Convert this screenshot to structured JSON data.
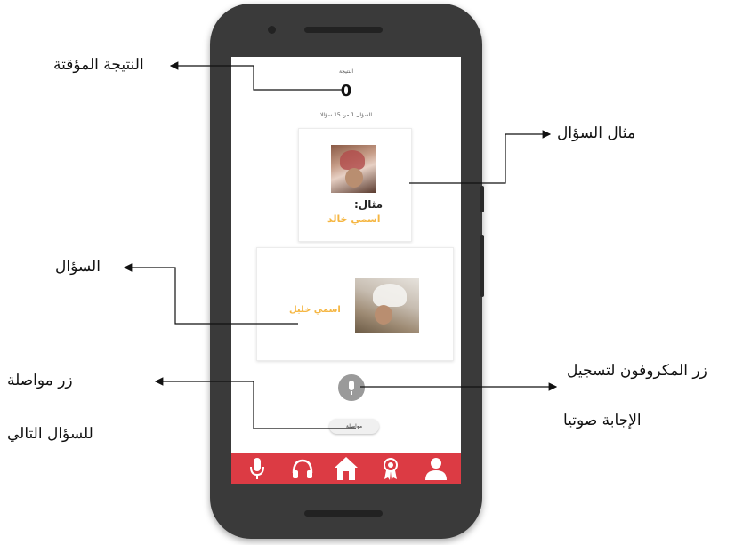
{
  "app": {
    "score_label": "النتيجة",
    "score_value": "0",
    "progress_text": "السؤال 1 من 15 سؤالا",
    "example_label": "مثال:",
    "example_name": "اسمي خالد",
    "question_name": "اسمي خليل",
    "continue_label": "مواصلة",
    "mic_icon": "mic-icon",
    "nav": [
      {
        "name": "nav-mic",
        "icon": "mic-icon"
      },
      {
        "name": "nav-headphones",
        "icon": "headphones-icon"
      },
      {
        "name": "nav-home",
        "icon": "home-icon"
      },
      {
        "name": "nav-award",
        "icon": "award-icon"
      },
      {
        "name": "nav-profile",
        "icon": "user-icon"
      }
    ],
    "colors": {
      "nav_bar": "#dc3b44",
      "name_text": "#f5b642",
      "mic_button": "#9a9a9a"
    }
  },
  "annotations": {
    "temp_score": "النتيجة المؤقتة",
    "question_example": "مثال السؤال",
    "question": "السؤال",
    "continue_line1": "زر مواصلة",
    "continue_line2": "للسؤال التالي",
    "mic_line1": "زر المكروفون لتسجيل",
    "mic_line2": "الإجابة صوتيا"
  }
}
